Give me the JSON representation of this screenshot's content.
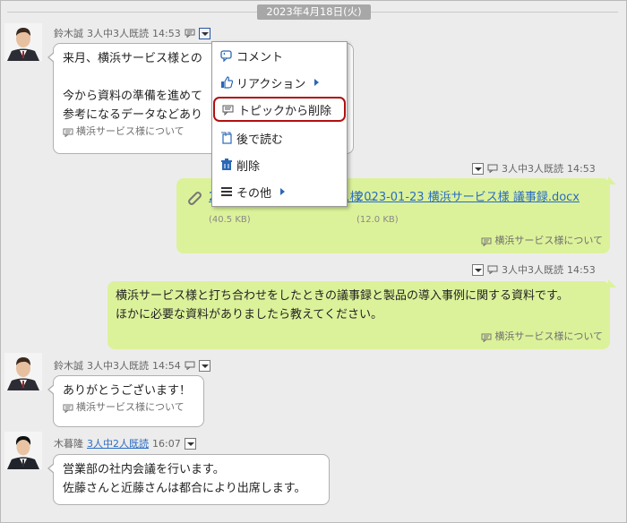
{
  "date_label": "2023年4月18日(火)",
  "messages": [
    {
      "sender": "鈴木誠",
      "read": "3人中3人既読",
      "time": "14:53",
      "lines": [
        "来月、横浜サービス様との",
        "",
        "今から資料の準備を進めて",
        "参考になるデータなどあり"
      ],
      "topic": "横浜サービス様について"
    },
    {
      "read": "3人中3人既読",
      "time": "14:53",
      "attachments": [
        {
          "name": "2023-01-23 横浜サービス様 ...",
          "size": "(40.5 KB)"
        },
        {
          "name": "2023-01-23 横浜サービス様 議事録.docx",
          "size": "(12.0 KB)"
        }
      ],
      "topic": "横浜サービス様について"
    },
    {
      "read": "3人中3人既読",
      "time": "14:53",
      "lines": [
        "横浜サービス様と打ち合わせをしたときの議事録と製品の導入事例に関する資料です。",
        "ほかに必要な資料がありましたら教えてください。"
      ],
      "topic": "横浜サービス様について"
    },
    {
      "sender": "鈴木誠",
      "read": "3人中3人既読",
      "time": "14:54",
      "lines": [
        "ありがとうございます！"
      ],
      "topic": "横浜サービス様について"
    },
    {
      "sender": "木暮隆",
      "read": "3人中2人既読",
      "time": "16:07",
      "lines": [
        "営業部の社内会議を行います。",
        "佐藤さんと近藤さんは都合により出席します。"
      ]
    }
  ],
  "menu": {
    "items": [
      {
        "label": "コメント",
        "icon": "comment-icon"
      },
      {
        "label": "リアクション",
        "icon": "thumbs-up-icon",
        "submenu": true
      },
      {
        "label": "トピックから削除",
        "icon": "topic-remove-icon",
        "highlighted": true
      },
      {
        "label": "後で読む",
        "icon": "read-later-icon"
      },
      {
        "label": "削除",
        "icon": "trash-icon"
      },
      {
        "label": "その他",
        "icon": "list-icon",
        "submenu": true
      }
    ]
  },
  "colors": {
    "outgoing_bubble": "#dcf29a",
    "link": "#2a6cc4",
    "highlight_border": "#b01010"
  }
}
